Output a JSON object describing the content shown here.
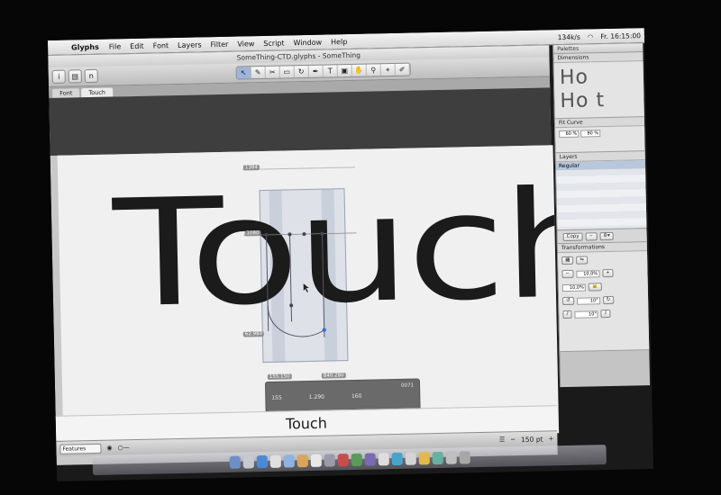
{
  "menubar": {
    "app_name": "Glyphs",
    "items": [
      "File",
      "Edit",
      "Font",
      "Layers",
      "Filter",
      "View",
      "Script",
      "Window",
      "Help"
    ],
    "clock": "Fr. 16:15:00",
    "speed": "134k/s"
  },
  "window": {
    "title": "SomeThing-CTD.glyphs - SomeThing",
    "tabs": [
      "Font",
      "Touch"
    ]
  },
  "canvas": {
    "glyph_text": "Touch",
    "metric_labels": [
      "1384",
      "1080",
      "62.980"
    ],
    "node_coords": [
      "155.150",
      "840.280"
    ],
    "info": {
      "x": "155",
      "width": "1.290",
      "height": "160",
      "code": "0071"
    }
  },
  "preview": {
    "text": "Touch"
  },
  "statusbar": {
    "features_label": "Features",
    "zoom": "150 pt"
  },
  "palettes": {
    "title": "Palettes",
    "dimensions_label": "Dimensions",
    "fit_curve_label": "Fit Curve",
    "fit_values": [
      "60 %",
      "80 %"
    ],
    "layers_label": "Layers",
    "layer_name": "Regular",
    "copy_label": "Copy",
    "transformations_label": "Transformations",
    "scale_values": [
      "10,0%",
      "10,0%"
    ],
    "rotate_value": "10°",
    "slant_value": "10°"
  },
  "colors": {
    "accent": "#9fb4d8",
    "band": "#3e3e3e"
  }
}
